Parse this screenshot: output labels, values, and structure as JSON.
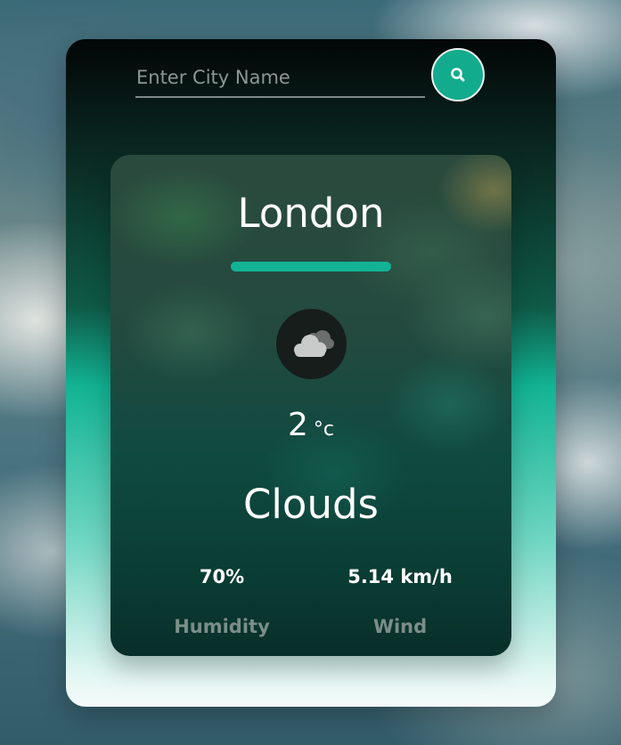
{
  "colors": {
    "accent": "#13ab8d",
    "divider": "#12b394",
    "text_primary": "#ffffff",
    "text_muted": "#7b8e88"
  },
  "search": {
    "placeholder": "Enter City Name",
    "value": "",
    "button_icon": "search-icon"
  },
  "weather": {
    "city": "London",
    "icon": "clouds-icon",
    "temperature": "2",
    "unit": "°c",
    "condition": "Clouds",
    "humidity": {
      "value": "70%",
      "label": "Humidity"
    },
    "wind": {
      "value": "5.14 km/h",
      "label": "Wind"
    }
  }
}
